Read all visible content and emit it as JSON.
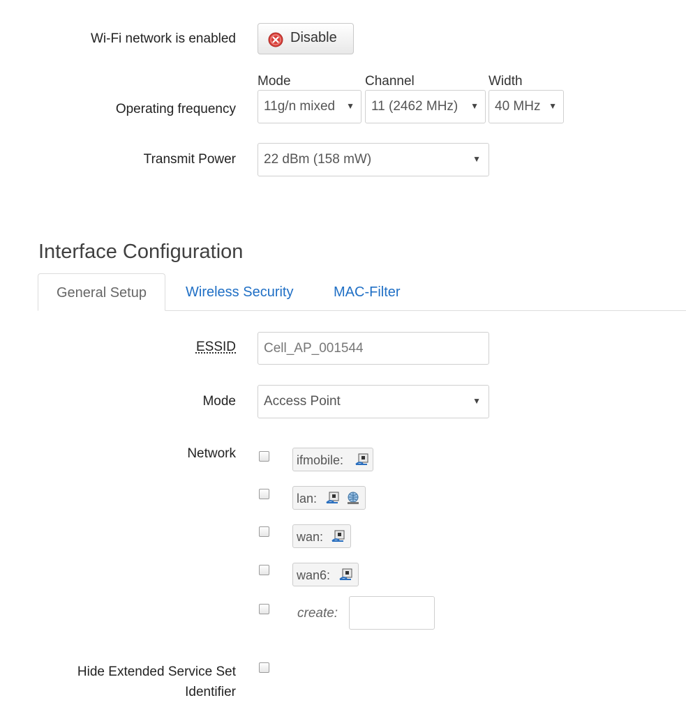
{
  "wifi": {
    "status_label": "Wi-Fi network is enabled",
    "disable_button": "Disable"
  },
  "frequency": {
    "label": "Operating frequency",
    "mode_label": "Mode",
    "mode_value": "11g/n mixed",
    "channel_label": "Channel",
    "channel_value": "11 (2462 MHz)",
    "width_label": "Width",
    "width_value": "40 MHz"
  },
  "power": {
    "label": "Transmit Power",
    "value": "22 dBm (158 mW)"
  },
  "section": {
    "title": "Interface Configuration",
    "tabs": [
      "General Setup",
      "Wireless Security",
      "MAC-Filter"
    ]
  },
  "essid": {
    "label": "ESSID",
    "value": "Cell_AP_001544"
  },
  "mode": {
    "label": "Mode",
    "value": "Access Point"
  },
  "network": {
    "label": "Network",
    "items": [
      {
        "name": "ifmobile:",
        "icons": [
          "ethernet-port-icon"
        ]
      },
      {
        "name": "lan:",
        "icons": [
          "ethernet-port-icon",
          "wireless-globe-icon"
        ]
      },
      {
        "name": "wan:",
        "icons": [
          "ethernet-port-icon"
        ]
      },
      {
        "name": "wan6:",
        "icons": [
          "ethernet-port-icon"
        ]
      }
    ],
    "create_label": "create:",
    "create_value": ""
  },
  "hide_essid": {
    "label_line1": "Hide Extended Service Set",
    "label_line2": "Identifier"
  },
  "colors": {
    "link": "#1f6fc5",
    "disable_icon": "#d9413b"
  }
}
